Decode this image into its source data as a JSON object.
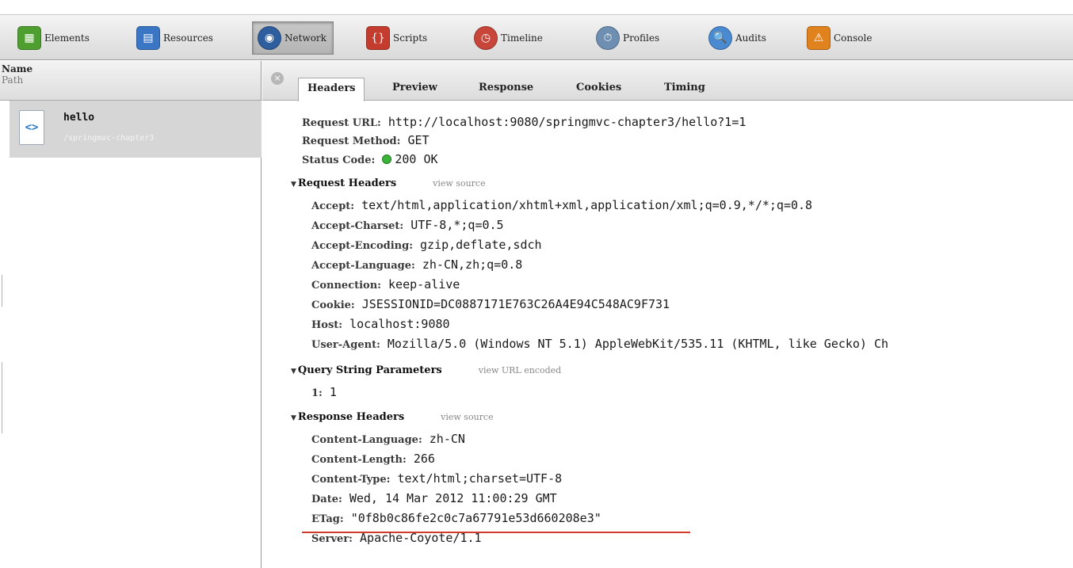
{
  "toolbar": {
    "items": [
      {
        "label": "Elements",
        "icon": "elements-icon",
        "color": "#4e9f2f"
      },
      {
        "label": "Resources",
        "icon": "resources-icon",
        "color": "#3a76c4"
      },
      {
        "label": "Network",
        "icon": "network-icon",
        "color": "#2f5e9e"
      },
      {
        "label": "Scripts",
        "icon": "scripts-icon",
        "color": "#c33c2e"
      },
      {
        "label": "Timeline",
        "icon": "timeline-icon",
        "color": "#c8453a"
      },
      {
        "label": "Profiles",
        "icon": "profiles-icon",
        "color": "#6e8fb1"
      },
      {
        "label": "Audits",
        "icon": "audits-icon",
        "color": "#4a8ad0"
      },
      {
        "label": "Console",
        "icon": "console-icon",
        "color": "#e0821e"
      }
    ],
    "active": "Network"
  },
  "sidebar": {
    "header_name": "Name",
    "header_path": "Path",
    "request": {
      "name": "hello",
      "path": "/springmvc-chapter3",
      "icon_glyph": "<>"
    }
  },
  "tabs": [
    "Headers",
    "Preview",
    "Response",
    "Cookies",
    "Timing"
  ],
  "active_tab": "Headers",
  "general": {
    "request_url_key": "Request URL:",
    "request_url": "http://localhost:9080/springmvc-chapter3/hello?1=1",
    "request_method_key": "Request Method:",
    "request_method": "GET",
    "status_code_key": "Status Code:",
    "status_code": "200 OK",
    "status_color": "#3bb33b"
  },
  "request_headers": {
    "title": "Request Headers",
    "link": "view source",
    "items": [
      {
        "k": "Accept:",
        "v": "text/html,application/xhtml+xml,application/xml;q=0.9,*/*;q=0.8"
      },
      {
        "k": "Accept-Charset:",
        "v": "UTF-8,*;q=0.5"
      },
      {
        "k": "Accept-Encoding:",
        "v": "gzip,deflate,sdch"
      },
      {
        "k": "Accept-Language:",
        "v": "zh-CN,zh;q=0.8"
      },
      {
        "k": "Connection:",
        "v": "keep-alive"
      },
      {
        "k": "Cookie:",
        "v": "JSESSIONID=DC0887171E763C26A4E94C548AC9F731"
      },
      {
        "k": "Host:",
        "v": "localhost:9080"
      },
      {
        "k": "User-Agent:",
        "v": "Mozilla/5.0 (Windows NT 5.1) AppleWebKit/535.11 (KHTML, like Gecko) Ch"
      }
    ]
  },
  "query_params": {
    "title": "Query String Parameters",
    "link": "view URL encoded",
    "items": [
      {
        "k": "1:",
        "v": "1"
      }
    ]
  },
  "response_headers": {
    "title": "Response Headers",
    "link": "view source",
    "items": [
      {
        "k": "Content-Language:",
        "v": "zh-CN"
      },
      {
        "k": "Content-Length:",
        "v": "266"
      },
      {
        "k": "Content-Type:",
        "v": "text/html;charset=UTF-8"
      },
      {
        "k": "Date:",
        "v": "Wed, 14 Mar 2012 11:00:29 GMT"
      },
      {
        "k": "ETag:",
        "v": "\"0f8b0c86fe2c0c7a67791e53d660208e3\""
      },
      {
        "k": "Server:",
        "v": "Apache-Coyote/1.1"
      }
    ]
  },
  "highlight_color": "#d23a2a"
}
